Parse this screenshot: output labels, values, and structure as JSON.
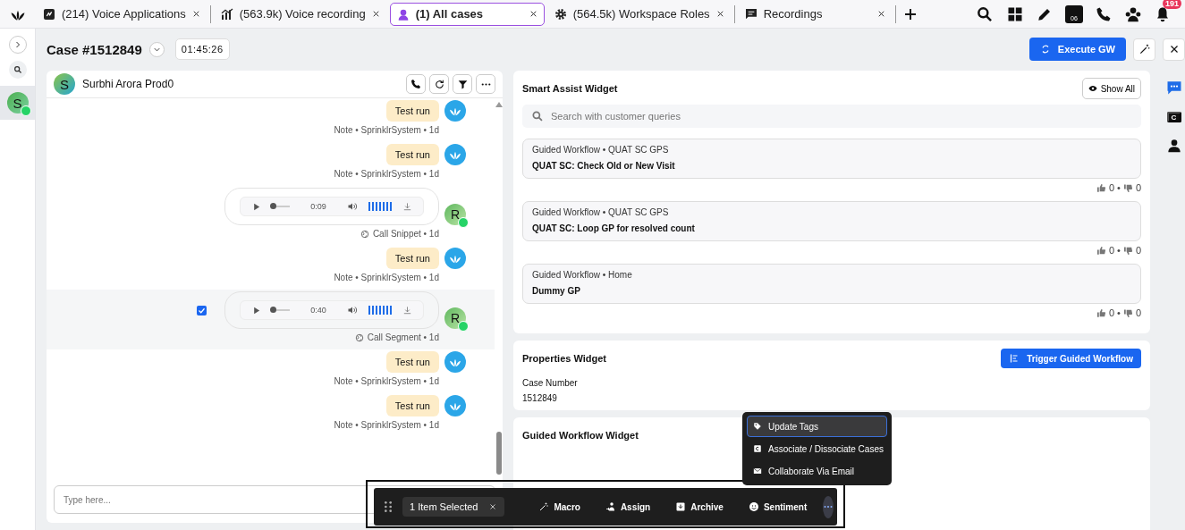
{
  "tabs": [
    {
      "label": "(214) Voice Applications",
      "selected": false
    },
    {
      "label": "(563.9k) Voice recording",
      "selected": false
    },
    {
      "label": "(1) All cases",
      "selected": true
    },
    {
      "label": "(564.5k) Workspace Roles",
      "selected": false
    },
    {
      "label": "Recordings",
      "selected": false
    }
  ],
  "toolbar": {
    "calendar_day": "06",
    "notification_count": "191"
  },
  "left_rail": {
    "avatar": "S",
    "avatar_selected": true
  },
  "case_header": {
    "title": "Case #1512849",
    "timer": "01:45:26",
    "execute_button": "Execute GW"
  },
  "conversation": {
    "contact_avatar": "S",
    "contact_name": "Surbhi Arora Prod0",
    "messages": [
      {
        "kind": "note",
        "text": "Test run",
        "meta": "Note • SprinklrSystem • 1d",
        "selected": false
      },
      {
        "kind": "note",
        "text": "Test run",
        "meta": "Note • SprinklrSystem • 1d",
        "selected": false
      },
      {
        "kind": "audio",
        "time": "0:09",
        "meta": "Call Snippet • 1d",
        "avatar": "R",
        "selected": false
      },
      {
        "kind": "note",
        "text": "Test run",
        "meta": "Note • SprinklrSystem • 1d",
        "selected": false
      },
      {
        "kind": "audio",
        "time": "0:40",
        "meta": "Call Segment • 1d",
        "avatar": "R",
        "selected": true
      },
      {
        "kind": "note",
        "text": "Test run",
        "meta": "Note • SprinklrSystem • 1d",
        "selected": false
      },
      {
        "kind": "note",
        "text": "Test run",
        "meta": "Note • SprinklrSystem • 1d",
        "selected": false
      }
    ],
    "composer": {
      "placeholder": "Type here..."
    }
  },
  "smart_assist": {
    "title": "Smart Assist Widget",
    "show_all": "Show All",
    "search": {
      "placeholder": "Search with customer queries"
    },
    "cards": [
      {
        "meta": "Guided Workflow • QUAT SC GPS",
        "title": "QUAT SC: Check Old or New Visit",
        "likes": "0",
        "separator": "•",
        "dislikes": "0"
      },
      {
        "meta": "Guided Workflow • QUAT SC GPS",
        "title": "QUAT SC: Loop GP for resolved count",
        "likes": "0",
        "separator": "•",
        "dislikes": "0"
      },
      {
        "meta": "Guided Workflow • Home",
        "title": "Dummy GP",
        "likes": "0",
        "separator": "•",
        "dislikes": "0"
      }
    ]
  },
  "properties": {
    "title": "Properties Widget",
    "trigger_button": "Trigger Guided Workflow",
    "field_label": "Case Number",
    "field_value": "1512849"
  },
  "guided_workflow": {
    "title": "Guided Workflow Widget"
  },
  "right_rail": {
    "letter": "C"
  },
  "action_bar": {
    "selection": "1 Item Selected",
    "actions": [
      {
        "label": "Macro"
      },
      {
        "label": "Assign"
      },
      {
        "label": "Archive"
      },
      {
        "label": "Sentiment"
      }
    ],
    "more_active": true
  },
  "more_menu": [
    {
      "label": "Update Tags",
      "selected": true
    },
    {
      "label": "Associate / Dissociate Cases",
      "selected": false
    },
    {
      "label": "Collaborate Via Email",
      "selected": false
    }
  ]
}
